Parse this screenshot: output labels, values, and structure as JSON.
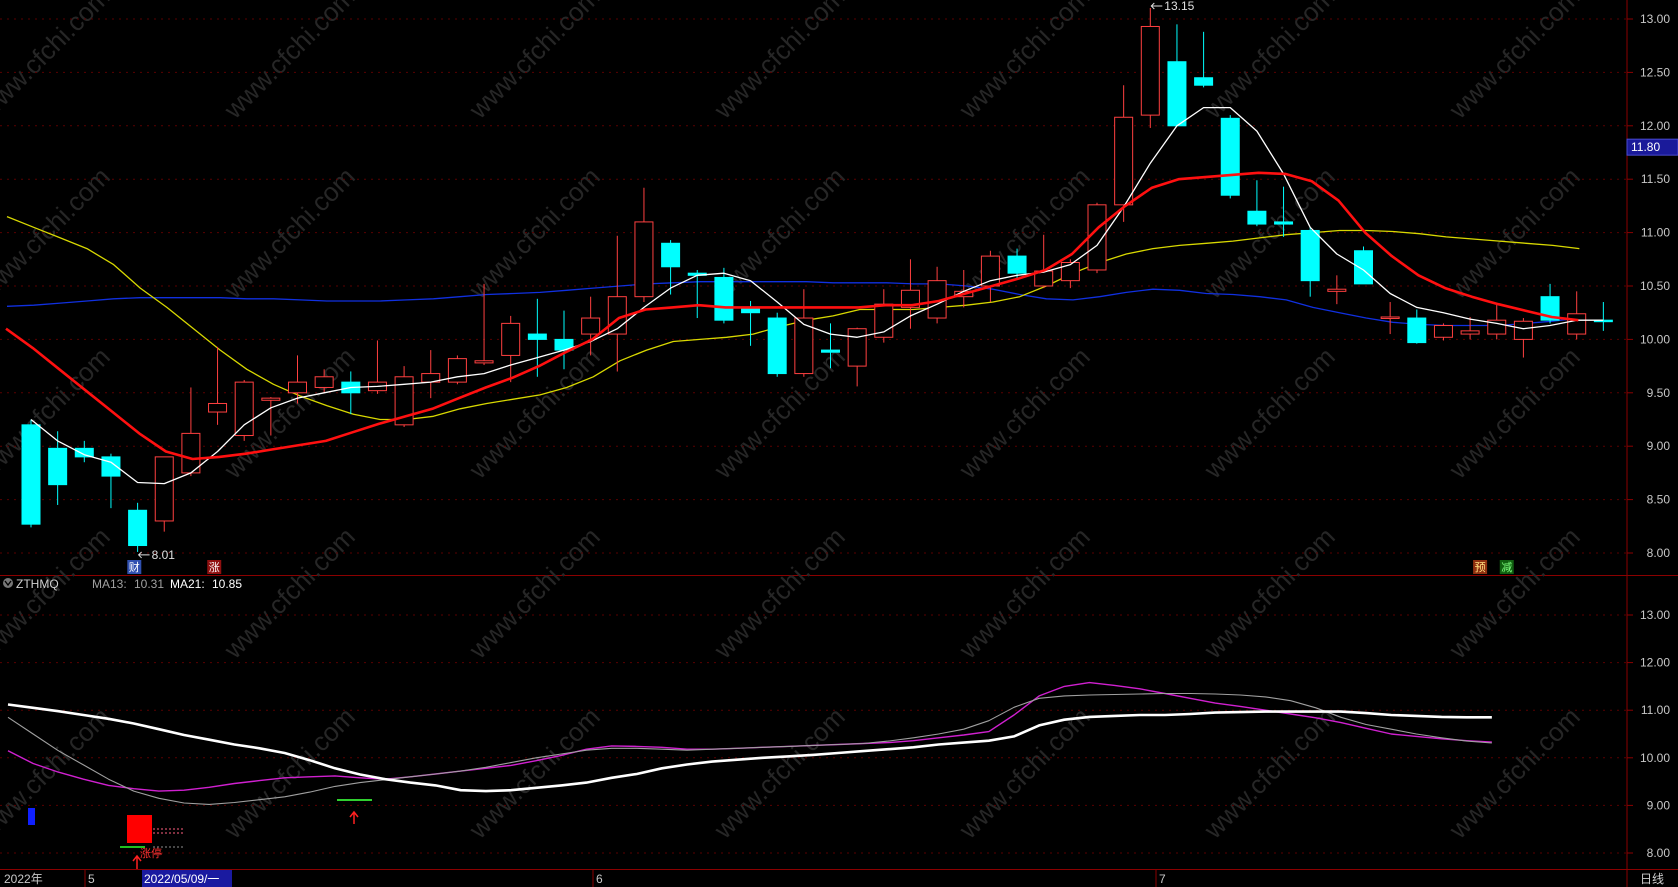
{
  "colors": {
    "background": "#000000",
    "frame": "#8b0000",
    "grid": "#5a0000",
    "axis_text": "#c8c8c8",
    "candle_up": "#ff4040",
    "candle_down": "#00ffff",
    "ma_white": "#ffffff",
    "ma_red": "#ff1010",
    "ma_yellow": "#d8d800",
    "ma_blue": "#1030e0",
    "watermark": "#262626"
  },
  "watermark_text": "www.cfchi.com",
  "top_panel": {
    "price_tag": "11.80",
    "max_label": "13.15",
    "min_label": "8.01",
    "events": [
      {
        "label": "财",
        "index": 2
      },
      {
        "label": "涨",
        "index": 5
      },
      {
        "label": "预",
        "index": 54
      },
      {
        "label": "减",
        "index": 55
      }
    ]
  },
  "bottom_panel": {
    "indicator_name": "ZTHMQ",
    "ma13_label": "MA13:",
    "ma13_value": "10.31",
    "ma21_label": "MA21:",
    "ma21_value": "10.85",
    "ma13_color": "#a0a0a0",
    "ma21_color": "#ffffff",
    "signal_text": "涨停"
  },
  "footer": {
    "year_label": "2022年",
    "month_5": "5",
    "date_box": "2022/05/09/一",
    "month_6": "6",
    "month_7": "7",
    "period_label": "日线"
  },
  "chart_data": [
    {
      "type": "candlestick",
      "ylim": [
        7.9,
        13.2
      ],
      "yticks": [
        "8.00",
        "8.50",
        "9.00",
        "9.50",
        "10.00",
        "10.50",
        "11.00",
        "11.50",
        "12.00",
        "12.50",
        "13.00"
      ],
      "candles": [
        {
          "o": 9.2,
          "h": 9.25,
          "l": 8.24,
          "c": 8.27
        },
        {
          "o": 8.98,
          "h": 9.14,
          "l": 8.45,
          "c": 8.64
        },
        {
          "o": 8.98,
          "h": 9.05,
          "l": 8.85,
          "c": 8.9
        },
        {
          "o": 8.9,
          "h": 8.93,
          "l": 8.42,
          "c": 8.72
        },
        {
          "o": 8.4,
          "h": 8.47,
          "l": 8.01,
          "c": 8.07
        },
        {
          "o": 8.3,
          "h": 8.9,
          "l": 8.2,
          "c": 8.9
        },
        {
          "o": 8.75,
          "h": 9.55,
          "l": 8.72,
          "c": 9.12
        },
        {
          "o": 9.32,
          "h": 9.93,
          "l": 9.2,
          "c": 9.4
        },
        {
          "o": 9.1,
          "h": 9.62,
          "l": 9.05,
          "c": 9.6
        },
        {
          "o": 9.43,
          "h": 9.46,
          "l": 9.1,
          "c": 9.45
        },
        {
          "o": 9.5,
          "h": 9.85,
          "l": 9.4,
          "c": 9.6
        },
        {
          "o": 9.55,
          "h": 9.72,
          "l": 9.5,
          "c": 9.65
        },
        {
          "o": 9.6,
          "h": 9.7,
          "l": 9.3,
          "c": 9.5
        },
        {
          "o": 9.52,
          "h": 9.99,
          "l": 9.49,
          "c": 9.6
        },
        {
          "o": 9.2,
          "h": 9.75,
          "l": 9.18,
          "c": 9.65
        },
        {
          "o": 9.6,
          "h": 9.9,
          "l": 9.45,
          "c": 9.68
        },
        {
          "o": 9.6,
          "h": 9.85,
          "l": 9.58,
          "c": 9.82
        },
        {
          "o": 9.78,
          "h": 10.52,
          "l": 9.76,
          "c": 9.8
        },
        {
          "o": 9.85,
          "h": 10.22,
          "l": 9.6,
          "c": 10.15
        },
        {
          "o": 10.05,
          "h": 10.38,
          "l": 9.65,
          "c": 10.0
        },
        {
          "o": 10.0,
          "h": 10.27,
          "l": 9.72,
          "c": 9.9
        },
        {
          "o": 10.05,
          "h": 10.4,
          "l": 9.85,
          "c": 10.2
        },
        {
          "o": 10.05,
          "h": 10.97,
          "l": 9.7,
          "c": 10.4
        },
        {
          "o": 10.4,
          "h": 11.42,
          "l": 10.35,
          "c": 11.1
        },
        {
          "o": 10.9,
          "h": 10.93,
          "l": 10.42,
          "c": 10.68
        },
        {
          "o": 10.62,
          "h": 10.65,
          "l": 10.2,
          "c": 10.6
        },
        {
          "o": 10.58,
          "h": 10.67,
          "l": 10.15,
          "c": 10.18
        },
        {
          "o": 10.3,
          "h": 10.36,
          "l": 9.94,
          "c": 10.25
        },
        {
          "o": 10.2,
          "h": 10.25,
          "l": 9.65,
          "c": 9.68
        },
        {
          "o": 9.68,
          "h": 10.47,
          "l": 9.65,
          "c": 10.2
        },
        {
          "o": 9.9,
          "h": 10.15,
          "l": 9.73,
          "c": 9.88
        },
        {
          "o": 9.75,
          "h": 10.11,
          "l": 9.56,
          "c": 10.1
        },
        {
          "o": 10.02,
          "h": 10.47,
          "l": 9.97,
          "c": 10.33
        },
        {
          "o": 10.3,
          "h": 10.75,
          "l": 10.1,
          "c": 10.46
        },
        {
          "o": 10.2,
          "h": 10.68,
          "l": 10.15,
          "c": 10.55
        },
        {
          "o": 10.4,
          "h": 10.65,
          "l": 10.3,
          "c": 10.45
        },
        {
          "o": 10.5,
          "h": 10.83,
          "l": 10.35,
          "c": 10.78
        },
        {
          "o": 10.78,
          "h": 10.85,
          "l": 10.56,
          "c": 10.62
        },
        {
          "o": 10.5,
          "h": 10.98,
          "l": 10.48,
          "c": 10.64
        },
        {
          "o": 10.55,
          "h": 10.75,
          "l": 10.48,
          "c": 10.72
        },
        {
          "o": 10.65,
          "h": 11.28,
          "l": 10.62,
          "c": 11.26
        },
        {
          "o": 11.26,
          "h": 12.38,
          "l": 11.1,
          "c": 12.08
        },
        {
          "o": 12.1,
          "h": 13.15,
          "l": 11.98,
          "c": 12.93
        },
        {
          "o": 12.6,
          "h": 12.95,
          "l": 12.0,
          "c": 12.0
        },
        {
          "o": 12.45,
          "h": 12.88,
          "l": 12.36,
          "c": 12.38
        },
        {
          "o": 12.07,
          "h": 12.1,
          "l": 11.32,
          "c": 11.35
        },
        {
          "o": 11.2,
          "h": 11.49,
          "l": 11.06,
          "c": 11.08
        },
        {
          "o": 11.1,
          "h": 11.43,
          "l": 10.96,
          "c": 11.08
        },
        {
          "o": 11.02,
          "h": 11.05,
          "l": 10.4,
          "c": 10.55
        },
        {
          "o": 10.45,
          "h": 10.6,
          "l": 10.33,
          "c": 10.47
        },
        {
          "o": 10.83,
          "h": 10.87,
          "l": 10.52,
          "c": 10.52
        },
        {
          "o": 10.2,
          "h": 10.35,
          "l": 10.05,
          "c": 10.21
        },
        {
          "o": 10.2,
          "h": 10.28,
          "l": 9.96,
          "c": 9.97
        },
        {
          "o": 10.02,
          "h": 10.15,
          "l": 9.99,
          "c": 10.13
        },
        {
          "o": 10.05,
          "h": 10.21,
          "l": 10.0,
          "c": 10.08
        },
        {
          "o": 10.05,
          "h": 10.34,
          "l": 10.0,
          "c": 10.18
        },
        {
          "o": 10.0,
          "h": 10.2,
          "l": 9.83,
          "c": 10.17
        },
        {
          "o": 10.4,
          "h": 10.52,
          "l": 10.15,
          "c": 10.18
        },
        {
          "o": 10.05,
          "h": 10.45,
          "l": 10.0,
          "c": 10.24
        },
        {
          "o": 10.18,
          "h": 10.35,
          "l": 10.08,
          "c": 10.17
        }
      ],
      "ma_white": [
        9.25,
        9.05,
        8.92,
        8.85,
        8.66,
        8.65,
        8.75,
        8.95,
        9.2,
        9.36,
        9.45,
        9.5,
        9.55,
        9.56,
        9.58,
        9.6,
        9.65,
        9.68,
        9.76,
        9.83,
        9.9,
        9.98,
        10.1,
        10.3,
        10.48,
        10.6,
        10.62,
        10.55,
        10.35,
        10.14,
        10.05,
        10.02,
        10.07,
        10.22,
        10.33,
        10.45,
        10.55,
        10.6,
        10.63,
        10.7,
        10.88,
        11.24,
        11.65,
        12.0,
        12.17,
        12.17,
        11.95,
        11.55,
        11.05,
        10.8,
        10.65,
        10.43,
        10.3,
        10.25,
        10.19,
        10.15,
        10.1,
        10.13,
        10.18,
        10.18
      ],
      "ma_red": [
        10.1,
        9.92,
        9.72,
        9.52,
        9.32,
        9.12,
        8.95,
        8.88,
        8.9,
        8.93,
        8.97,
        9.01,
        9.05,
        9.13,
        9.21,
        9.28,
        9.35,
        9.45,
        9.55,
        9.64,
        9.75,
        9.88,
        10.0,
        10.2,
        10.28,
        10.3,
        10.32,
        10.3,
        10.3,
        10.3,
        10.3,
        10.3,
        10.3,
        10.32,
        10.32,
        10.36,
        10.43,
        10.5,
        10.57,
        10.65,
        10.8,
        11.05,
        11.25,
        11.42,
        11.5,
        11.52,
        11.54,
        11.56,
        11.55,
        11.48,
        11.3,
        11.0,
        10.78,
        10.6,
        10.48,
        10.4,
        10.33,
        10.27,
        10.21,
        10.18
      ],
      "ma_yellow": [
        11.15,
        11.05,
        10.95,
        10.85,
        10.7,
        10.48,
        10.3,
        10.1,
        9.9,
        9.72,
        9.58,
        9.47,
        9.38,
        9.3,
        9.25,
        9.25,
        9.28,
        9.35,
        9.4,
        9.44,
        9.48,
        9.55,
        9.65,
        9.8,
        9.9,
        9.98,
        10.0,
        10.02,
        10.05,
        10.12,
        10.18,
        10.22,
        10.28,
        10.28,
        10.28,
        10.3,
        10.32,
        10.35,
        10.4,
        10.5,
        10.62,
        10.72,
        10.8,
        10.85,
        10.88,
        10.9,
        10.92,
        10.95,
        10.98,
        11.0,
        11.02,
        11.02,
        11.01,
        10.99,
        10.96,
        10.94,
        10.92,
        10.9,
        10.88,
        10.85
      ],
      "ma_blue": [
        10.31,
        10.32,
        10.34,
        10.36,
        10.38,
        10.39,
        10.39,
        10.39,
        10.39,
        10.38,
        10.38,
        10.37,
        10.36,
        10.36,
        10.36,
        10.37,
        10.38,
        10.4,
        10.42,
        10.43,
        10.44,
        10.46,
        10.48,
        10.5,
        10.52,
        10.53,
        10.54,
        10.54,
        10.54,
        10.54,
        10.54,
        10.53,
        10.53,
        10.53,
        10.52,
        10.52,
        10.5,
        10.47,
        10.42,
        10.38,
        10.37,
        10.4,
        10.44,
        10.47,
        10.46,
        10.43,
        10.42,
        10.4,
        10.37,
        10.3,
        10.25,
        10.2,
        10.16,
        10.14,
        10.13,
        10.13,
        10.13,
        10.15,
        10.17,
        10.2
      ]
    },
    {
      "type": "line",
      "name": "ZTHMQ",
      "ylim": [
        7.85,
        13.9
      ],
      "yticks": [
        "8.00",
        "9.00",
        "10.00",
        "11.00",
        "12.00",
        "13.00"
      ],
      "series": [
        {
          "name": "MA21",
          "values": [
            11.12,
            11.05,
            10.98,
            10.9,
            10.82,
            10.72,
            10.6,
            10.48,
            10.38,
            10.28,
            10.2,
            10.1,
            9.95,
            9.78,
            9.65,
            9.55,
            9.48,
            9.42,
            9.32,
            9.3,
            9.32,
            9.37,
            9.42,
            9.48,
            9.58,
            9.66,
            9.78,
            9.86,
            9.92,
            9.96,
            10.0,
            10.03,
            10.06,
            10.1,
            10.14,
            10.18,
            10.22,
            10.28,
            10.32,
            10.36,
            10.45,
            10.68,
            10.8,
            10.86,
            10.88,
            10.9,
            10.9,
            10.92,
            10.95,
            10.96,
            10.97,
            10.97,
            10.97,
            10.97,
            10.94,
            10.9,
            10.88,
            10.86,
            10.85,
            10.85
          ]
        },
        {
          "name": "MA13",
          "values": [
            10.85,
            10.5,
            10.15,
            9.85,
            9.55,
            9.3,
            9.15,
            9.05,
            9.02,
            9.06,
            9.12,
            9.18,
            9.28,
            9.4,
            9.48,
            9.54,
            9.6,
            9.66,
            9.72,
            9.8,
            9.9,
            10.0,
            10.08,
            10.16,
            10.2,
            10.2,
            10.18,
            10.16,
            10.18,
            10.2,
            10.22,
            10.24,
            10.26,
            10.28,
            10.3,
            10.35,
            10.42,
            10.5,
            10.6,
            10.78,
            11.06,
            11.25,
            11.3,
            11.32,
            11.33,
            11.34,
            11.35,
            11.35,
            11.34,
            11.32,
            11.28,
            11.2,
            11.05,
            10.85,
            10.7,
            10.6,
            10.5,
            10.42,
            10.35,
            10.31
          ]
        },
        {
          "name": "MA_magenta",
          "values": [
            10.15,
            9.88,
            9.7,
            9.55,
            9.42,
            9.35,
            9.3,
            9.32,
            9.38,
            9.46,
            9.52,
            9.58,
            9.6,
            9.62,
            9.58,
            9.55,
            9.6,
            9.66,
            9.72,
            9.78,
            9.84,
            9.94,
            10.05,
            10.18,
            10.25,
            10.24,
            10.22,
            10.18,
            10.18,
            10.2,
            10.22,
            10.24,
            10.26,
            10.28,
            10.3,
            10.32,
            10.36,
            10.42,
            10.48,
            10.55,
            10.9,
            11.3,
            11.5,
            11.58,
            11.52,
            11.45,
            11.35,
            11.25,
            11.15,
            11.08,
            11.0,
            10.92,
            10.84,
            10.74,
            10.62,
            10.5,
            10.45,
            10.4,
            10.36,
            10.33
          ]
        }
      ]
    }
  ]
}
